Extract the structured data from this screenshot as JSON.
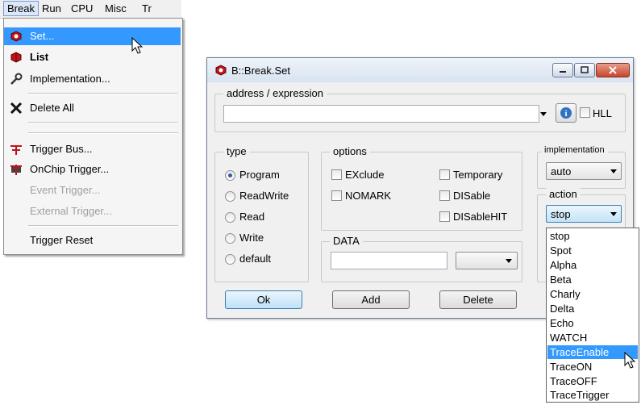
{
  "menubar": {
    "items": [
      "Break",
      "Run",
      "CPU",
      "Misc",
      "Tr"
    ]
  },
  "break_menu": {
    "items": [
      {
        "label": "Set...",
        "icon": "breakpoint-set-icon"
      },
      {
        "label": "List",
        "icon": "breakpoint-list-icon"
      },
      {
        "label": "Implementation...",
        "icon": "wrench-icon"
      },
      {
        "label": "Delete All",
        "icon": "delete-x-icon"
      },
      {
        "label": "Trigger Bus...",
        "icon": "trigger-bus-icon"
      },
      {
        "label": "OnChip Trigger...",
        "icon": "onchip-trigger-icon"
      },
      {
        "label": "Event Trigger...",
        "icon": ""
      },
      {
        "label": "External Trigger...",
        "icon": ""
      },
      {
        "label": "Trigger Reset",
        "icon": ""
      }
    ]
  },
  "dialog": {
    "title": "B::Break.Set",
    "address_group": "address / expression",
    "address_value": "",
    "hll_label": "HLL",
    "type_group": "type",
    "type_options": [
      "Program",
      "ReadWrite",
      "Read",
      "Write",
      "default"
    ],
    "type_selected": "Program",
    "options_group": "options",
    "options_left": [
      "EXclude",
      "NOMARK"
    ],
    "options_right": [
      "Temporary",
      "DISable",
      "DISableHIT"
    ],
    "data_group": "DATA",
    "data_value": "",
    "implementation_group": "implementation",
    "implementation_value": "auto",
    "action_group": "action",
    "action_value": "stop",
    "buttons": {
      "ok": "Ok",
      "add": "Add",
      "delete": "Delete"
    }
  },
  "action_list": {
    "items": [
      "stop",
      "Spot",
      "Alpha",
      "Beta",
      "Charly",
      "Delta",
      "Echo",
      "WATCH",
      "TraceEnable",
      "TraceON",
      "TraceOFF",
      "TraceTrigger"
    ],
    "highlighted": "TraceEnable"
  },
  "colors": {
    "selection": "#3399ff",
    "breakpoint_icon_red": "#c0141c"
  }
}
